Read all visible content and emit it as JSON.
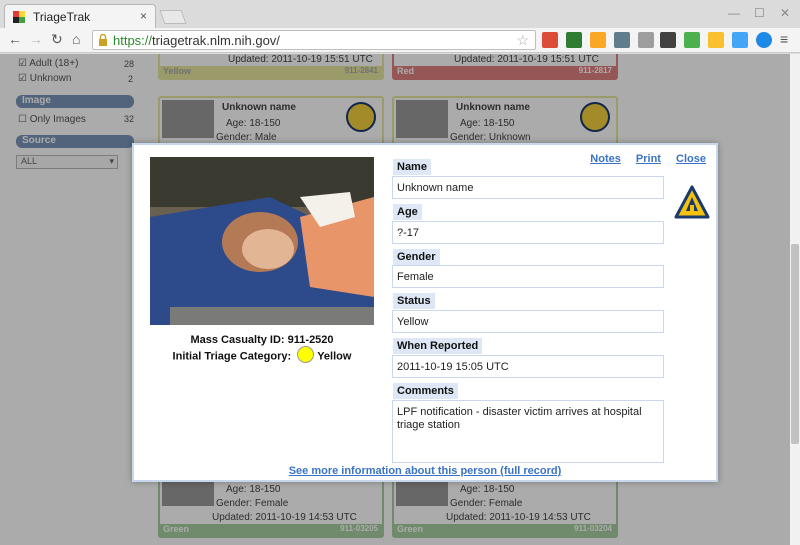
{
  "browser": {
    "tab_title": "TriageTrak",
    "tab_close": "×",
    "url_scheme": "https://",
    "url_rest": "triagetrak.nlm.nih.gov/",
    "back": "←",
    "forward": "→",
    "reload": "↻",
    "home": "⌂",
    "star": "☆",
    "menu": "≡",
    "win_min": "—",
    "win_max": "☐",
    "win_close": "✕"
  },
  "sidebar": {
    "filters": [
      {
        "label": "Adult (18+)",
        "count": "28"
      },
      {
        "label": "Unknown",
        "count": "2"
      }
    ],
    "image_header": "Image",
    "only_images": {
      "label": "Only Images",
      "count": "32"
    },
    "source_header": "Source",
    "source_select": "ALL"
  },
  "bg_cards": {
    "top_left": {
      "updated": "Updated: 2011-10-19 15:51 UTC",
      "status": "Yellow",
      "id": "911-2841"
    },
    "top_right": {
      "updated": "Updated: 2011-10-19 15:51 UTC",
      "status": "Red",
      "id": "911-2817"
    },
    "mid_left": {
      "name": "Unknown name",
      "age": "Age: 18-150",
      "gender": "Gender: Male"
    },
    "mid_right": {
      "name": "Unknown name",
      "age": "Age: 18-150",
      "gender": "Gender: Unknown"
    },
    "bot_left": {
      "age": "Age: 18-150",
      "gender": "Gender: Female",
      "updated": "Updated: 2011-10-19 14:53 UTC",
      "status": "Green",
      "id": "911-03205"
    },
    "bot_right": {
      "age": "Age: 18-150",
      "gender": "Gender: Female",
      "updated": "Updated: 2011-10-19 14:53 UTC",
      "status": "Green",
      "id": "911-03204"
    }
  },
  "modal": {
    "links": {
      "notes": "Notes",
      "print": "Print",
      "close": "Close"
    },
    "mass_casualty_id": "Mass Casualty ID: 911-2520",
    "triage_label": "Initial Triage Category:",
    "triage_value": "Yellow",
    "triage_color": "#ffff00",
    "fields": {
      "name_label": "Name",
      "name_value": "Unknown name",
      "age_label": "Age",
      "age_value": "?-17",
      "gender_label": "Gender",
      "gender_value": "Female",
      "status_label": "Status",
      "status_value": "Yellow",
      "reported_label": "When Reported",
      "reported_value": "2011-10-19 15:05 UTC",
      "comments_label": "Comments",
      "comments_value": "LPF notification - disaster victim arrives at hospital triage station"
    },
    "more_link": "See more information about this person (full record)"
  },
  "colors": {
    "accent_link": "#3a73c4",
    "label_bg": "#dde7f5",
    "yellow_status": "#e6e6a0",
    "red_status": "#e08080",
    "green_status": "#a8d0a0"
  }
}
